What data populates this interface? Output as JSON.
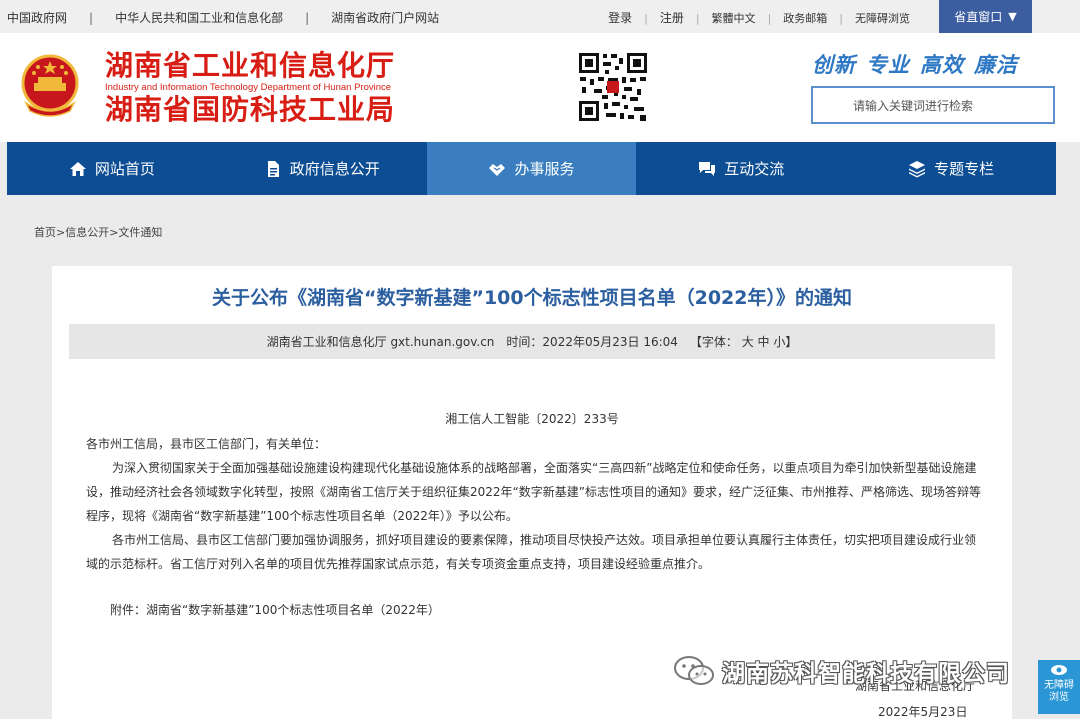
{
  "topbar": {
    "links_left": [
      "中国政府网",
      "中华人民共和国工业和信息化部",
      "湖南省政府门户网站"
    ],
    "separator": "|",
    "links_right": [
      "登录",
      "注册",
      "繁體中文",
      "政务邮箱",
      "无障碍浏览"
    ],
    "dropdown_label": "省直窗口",
    "dropdown_arrow": "▼"
  },
  "header": {
    "org_name_1": "湖南省工业和信息化厅",
    "org_name_en": "Industry and Information Technology Department of Hunan Province",
    "org_name_2": "湖南省国防科技工业局",
    "slogan": [
      "创新",
      "专业",
      "高效",
      "廉洁"
    ],
    "search_placeholder": "请输入关键词进行检索",
    "colors": {
      "brand_red": "#d81e14",
      "slogan_blue": "#2f78c4"
    }
  },
  "nav": {
    "items": [
      {
        "label": "网站首页",
        "icon": "home-icon"
      },
      {
        "label": "政府信息公开",
        "icon": "document-icon"
      },
      {
        "label": "办事服务",
        "icon": "handshake-icon",
        "active": true
      },
      {
        "label": "互动交流",
        "icon": "chat-icon"
      },
      {
        "label": "专题专栏",
        "icon": "layers-icon"
      }
    ],
    "colors": {
      "bg": "#0c4d93",
      "active_bg": "#3a7ebf"
    }
  },
  "breadcrumb": "首页>信息公开>文件通知",
  "article": {
    "title": "关于公布《湖南省“数字新基建”100个标志性项目名单（2022年）》的通知",
    "meta_source": "湖南省工业和信息化厅 gxt.hunan.gov.cn",
    "meta_time": "时间：2022年05月23日 16:04",
    "meta_font": "【字体：  大  中  小】",
    "doc_number": "湘工信人工智能〔2022〕233号",
    "salutation": "各市州工信局，县市区工信部门，有关单位：",
    "para1": "为深入贯彻国家关于全面加强基础设施建设构建现代化基础设施体系的战略部署，全面落实“三高四新”战略定位和使命任务，以重点项目为牵引加快新型基础设施建设，推动经济社会各领域数字化转型，按照《湖南省工信厅关于组织征集2022年“数字新基建”标志性项目的通知》要求，经广泛征集、市州推荐、严格筛选、现场答辩等程序，现将《湖南省“数字新基建”100个标志性项目名单（2022年）》予以公布。",
    "para2": "各市州工信局、县市区工信部门要加强协调服务，抓好项目建设的要素保障，推动项目尽快投产达效。项目承担单位要认真履行主体责任，切实把项目建设成行业领域的示范标杆。省工信厅对列入名单的项目优先推荐国家试点示范，有关专项资金重点支持，项目建设经验重点推介。",
    "attachment": "附件：湖南省“数字新基建”100个标志性项目名单（2022年）",
    "sign_org": "湖南省工业和信息化厅",
    "sign_date": "2022年5月23日",
    "title_color": "#2c5fa0"
  },
  "watermark": {
    "text": "湖南苏科智能科技有限公司",
    "icon": "wechat-icon"
  },
  "a11y_button": {
    "line1": "无障碍",
    "line2": "浏览",
    "icon": "eye-icon"
  }
}
